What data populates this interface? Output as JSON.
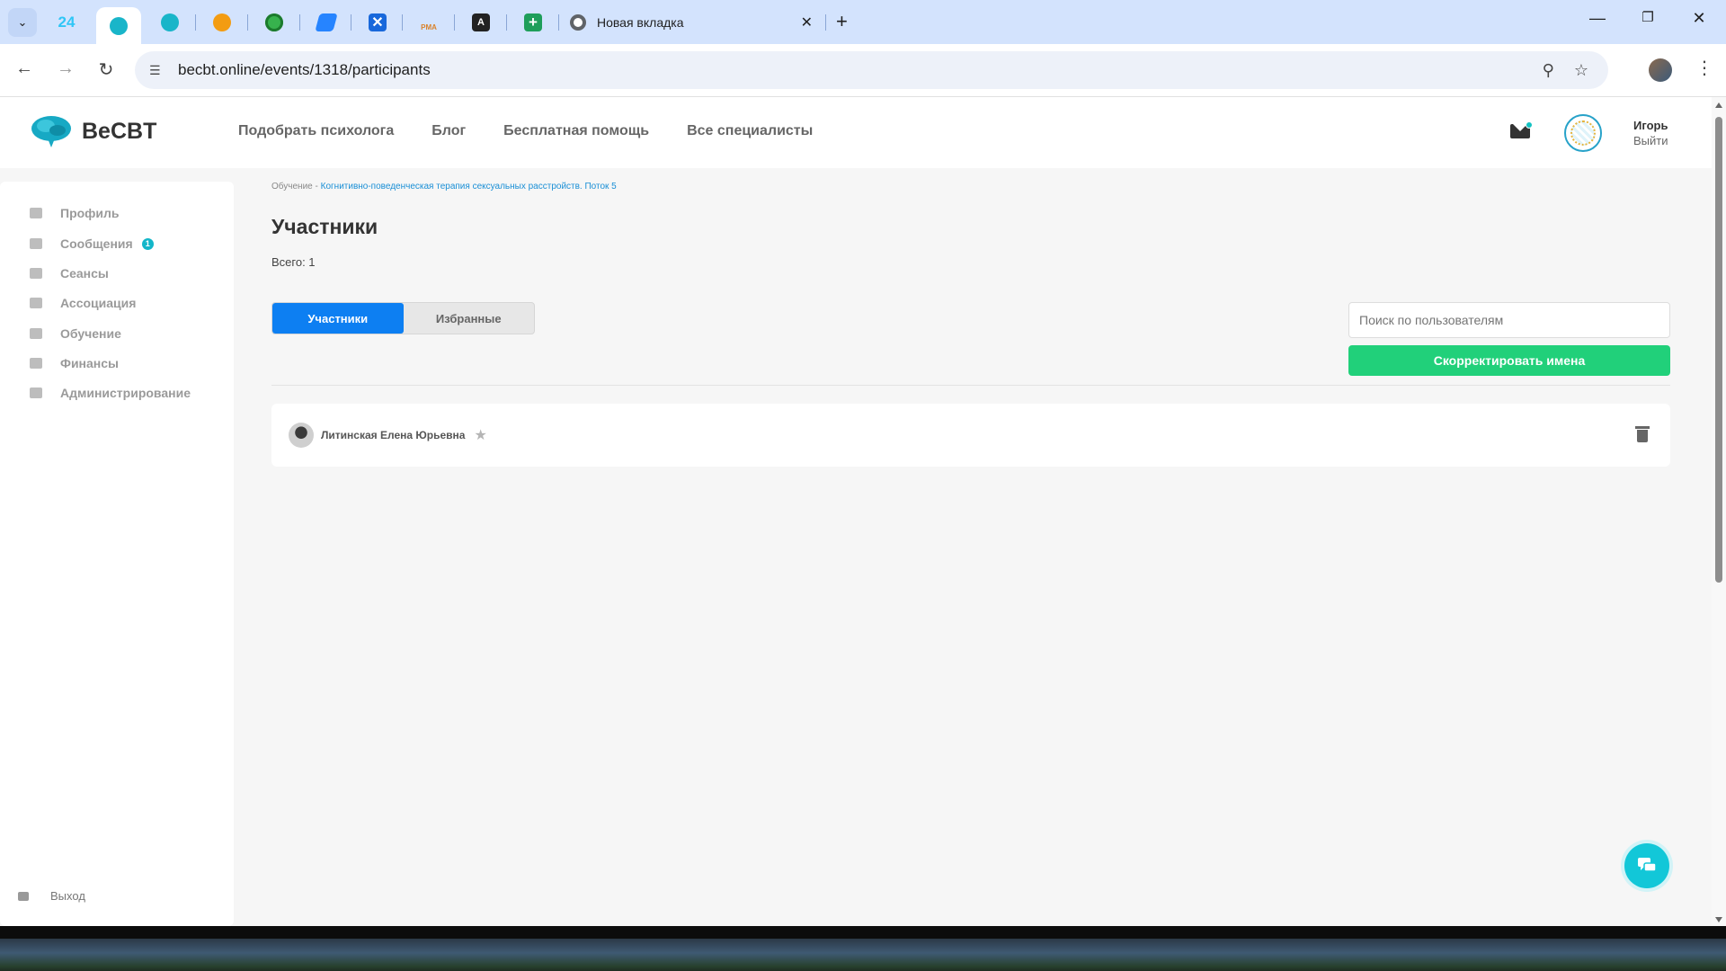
{
  "browser": {
    "pinned_tabs": [
      {
        "icon": "bitrix24-icon",
        "label": "24",
        "color": "#2fc6f6"
      },
      {
        "icon": "becbt-brain-icon",
        "label": "",
        "color": "#19b5c9"
      },
      {
        "icon": "becbt-brain-icon-2",
        "label": "",
        "color": "#19b5c9"
      },
      {
        "icon": "orange-app-icon",
        "label": "",
        "color": "#f39c12"
      },
      {
        "icon": "green-globe-icon",
        "label": "",
        "color": "#37b24d"
      },
      {
        "icon": "jira-icon",
        "label": "",
        "color": "#2684ff"
      },
      {
        "icon": "confluence-icon",
        "label": "",
        "color": "#1868db"
      },
      {
        "icon": "pma-icon",
        "label": "PMA",
        "color": "#d9822b"
      },
      {
        "icon": "letter-a-icon",
        "label": "A",
        "color": "#222"
      },
      {
        "icon": "sheets-plus-icon",
        "label": "+",
        "color": "#1e9e5a"
      }
    ],
    "new_tab_title": "Новая вкладка",
    "url": "becbt.online/events/1318/participants"
  },
  "site": {
    "logo_text": "BeCBT",
    "nav": [
      "Подобрать психолога",
      "Блог",
      "Бесплатная помощь",
      "Все специалисты"
    ],
    "user_name": "Игорь",
    "logout": "Выйти"
  },
  "sidebar": {
    "items": [
      {
        "label": "Профиль",
        "icon": "home-icon"
      },
      {
        "label": "Сообщения",
        "icon": "envelope-icon",
        "badge": "1"
      },
      {
        "label": "Сеансы",
        "icon": "calendar-icon"
      },
      {
        "label": "Ассоциация",
        "icon": "clipboard-icon"
      },
      {
        "label": "Обучение",
        "icon": "graduation-cap-icon"
      },
      {
        "label": "Финансы",
        "icon": "wallet-icon"
      },
      {
        "label": "Администрирование",
        "icon": "wrench-icon"
      }
    ],
    "exit_label": "Выход"
  },
  "main": {
    "breadcrumb_root": "Обучение",
    "breadcrumb_sep": "-",
    "breadcrumb_link": "Когнитивно-поведенческая терапия сексуальных расстройств. Поток 5",
    "title": "Участники",
    "total": "Всего: 1",
    "tabs": [
      "Участники",
      "Избранные"
    ],
    "search_placeholder": "Поиск по пользователям",
    "fix_button": "Скорректировать имена",
    "participants": [
      {
        "name": "Литинская Елена Юрьевна"
      }
    ]
  },
  "colors": {
    "accent_blue": "#0d7ff2",
    "accent_green": "#21d07a",
    "accent_teal": "#12c7d8"
  }
}
